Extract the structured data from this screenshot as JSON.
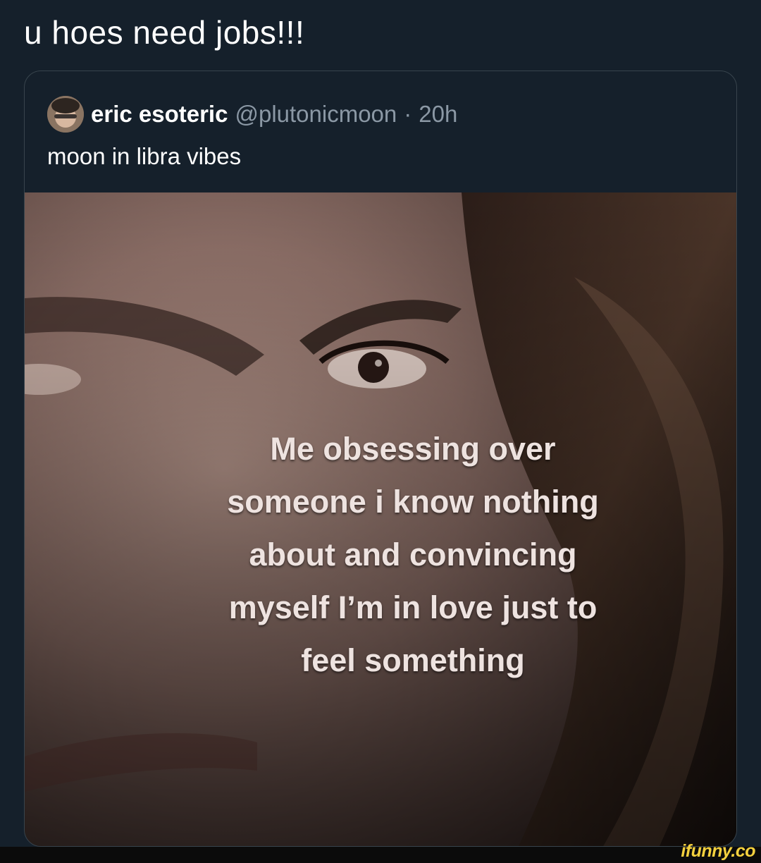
{
  "tweet": {
    "text": "u hoes need jobs!!!"
  },
  "quote": {
    "display_name": "eric esoteric",
    "handle": "@plutonicmoon",
    "separator": "·",
    "time": "20h",
    "text": "moon in libra vibes",
    "media": {
      "caption_lines": [
        "Me obsessing over",
        "someone i know nothing",
        "about and convincing",
        "myself I’m in love just to",
        "feel something"
      ]
    }
  },
  "watermark": {
    "text": "ifunny.co"
  },
  "colors": {
    "background": "#15202b",
    "border": "#38444d",
    "secondary_text": "#8b98a5",
    "watermark": "#f3d03e"
  }
}
